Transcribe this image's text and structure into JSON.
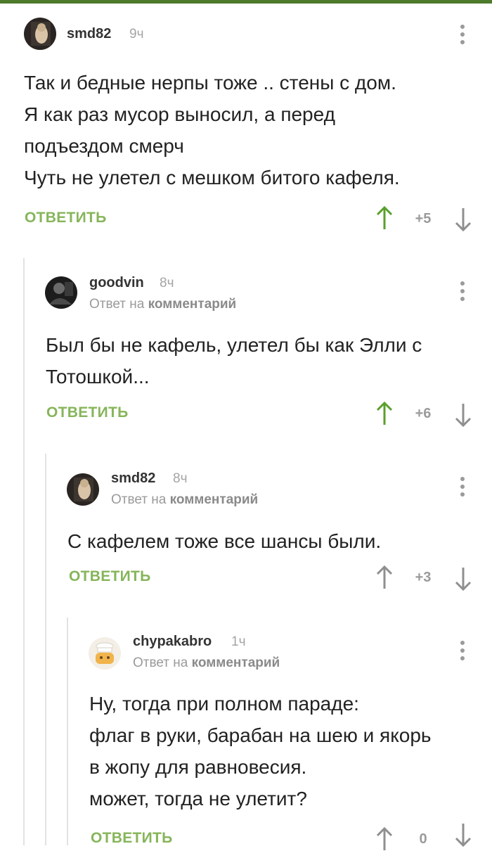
{
  "comments": [
    {
      "username": "smd82",
      "time": "9ч",
      "reply_prefix": "",
      "reply_link": "",
      "lines": [
        "Так и бедные нерпы тоже .. стены с дом.",
        "Я как раз мусор выносил, а перед",
        "подъездом смерч",
        "Чуть не улетел с мешком битого кафеля."
      ],
      "reply_label": "ОТВЕТИТЬ",
      "score": "+5",
      "upvote_active": true
    },
    {
      "username": "goodvin",
      "time": "8ч",
      "reply_prefix": "Ответ на",
      "reply_link": "комментарий",
      "lines": [
        "Был бы не кафель, улетел бы как Элли с",
        "Тотошкой..."
      ],
      "reply_label": "ОТВЕТИТЬ",
      "score": "+6",
      "upvote_active": true
    },
    {
      "username": "smd82",
      "time": "8ч",
      "reply_prefix": "Ответ на",
      "reply_link": "комментарий",
      "lines": [
        "С кафелем тоже все шансы были."
      ],
      "reply_label": "ОТВЕТИТЬ",
      "score": "+3",
      "upvote_active": false
    },
    {
      "username": "chypakabro",
      "time": "1ч",
      "reply_prefix": "Ответ на",
      "reply_link": "комментарий",
      "lines": [
        "Ну, тогда при полном параде:",
        "флаг в руки, барабан на шею и якорь",
        "в жопу для равновесия.",
        "может, тогда не улетит?"
      ],
      "reply_label": "ОТВЕТИТЬ",
      "score": "0",
      "upvote_active": false
    }
  ],
  "colors": {
    "accent_green": "#86b55a",
    "vote_active": "#5aa02c",
    "vote_inactive": "#9a9a9a",
    "thread_line": "#e2e2e2"
  }
}
